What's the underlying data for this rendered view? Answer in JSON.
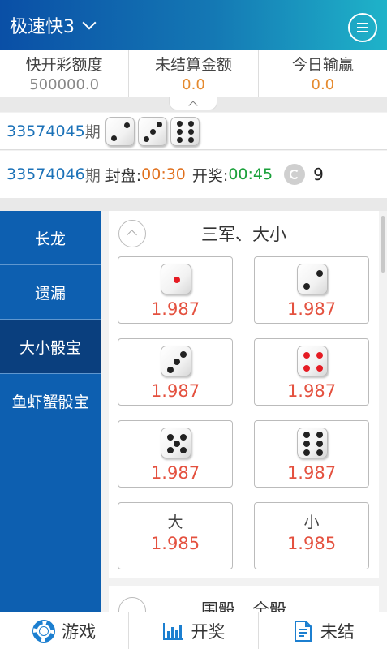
{
  "header": {
    "title": "极速快3"
  },
  "stats": [
    {
      "label": "快开彩额度",
      "value": "500000.0"
    },
    {
      "label": "未结算金额",
      "value": "0.0"
    },
    {
      "label": "今日输赢",
      "value": "0.0"
    }
  ],
  "last_draw": {
    "period": "33574045",
    "suffix": "期",
    "dice": [
      2,
      3,
      6
    ]
  },
  "current": {
    "period": "33574046",
    "suffix": "期",
    "close_label": "封盘:",
    "close_time": "00:30",
    "draw_label": "开奖:",
    "draw_time": "00:45",
    "count": "9"
  },
  "sidebar": {
    "items": [
      "长龙",
      "遗漏",
      "大小骰宝",
      "鱼虾蟹骰宝"
    ],
    "active_index": 2
  },
  "section1": {
    "title": "三军、大小",
    "cells": [
      {
        "face": 1,
        "odds": "1.987"
      },
      {
        "face": 2,
        "odds": "1.987"
      },
      {
        "face": 3,
        "odds": "1.987"
      },
      {
        "face": 4,
        "odds": "1.987"
      },
      {
        "face": 5,
        "odds": "1.987"
      },
      {
        "face": 6,
        "odds": "1.987"
      },
      {
        "label": "大",
        "odds": "1.985"
      },
      {
        "label": "小",
        "odds": "1.985"
      }
    ]
  },
  "section2": {
    "title": "围骰、全骰"
  },
  "bottom_nav": [
    {
      "label": "游戏",
      "icon": "lifebuoy-icon"
    },
    {
      "label": "开奖",
      "icon": "bar-chart-icon"
    },
    {
      "label": "未结",
      "icon": "document-icon"
    }
  ],
  "colors": {
    "accent": "#0d5fb0",
    "odds": "#e4513f",
    "orange": "#e0701d",
    "green": "#1aa03a"
  }
}
